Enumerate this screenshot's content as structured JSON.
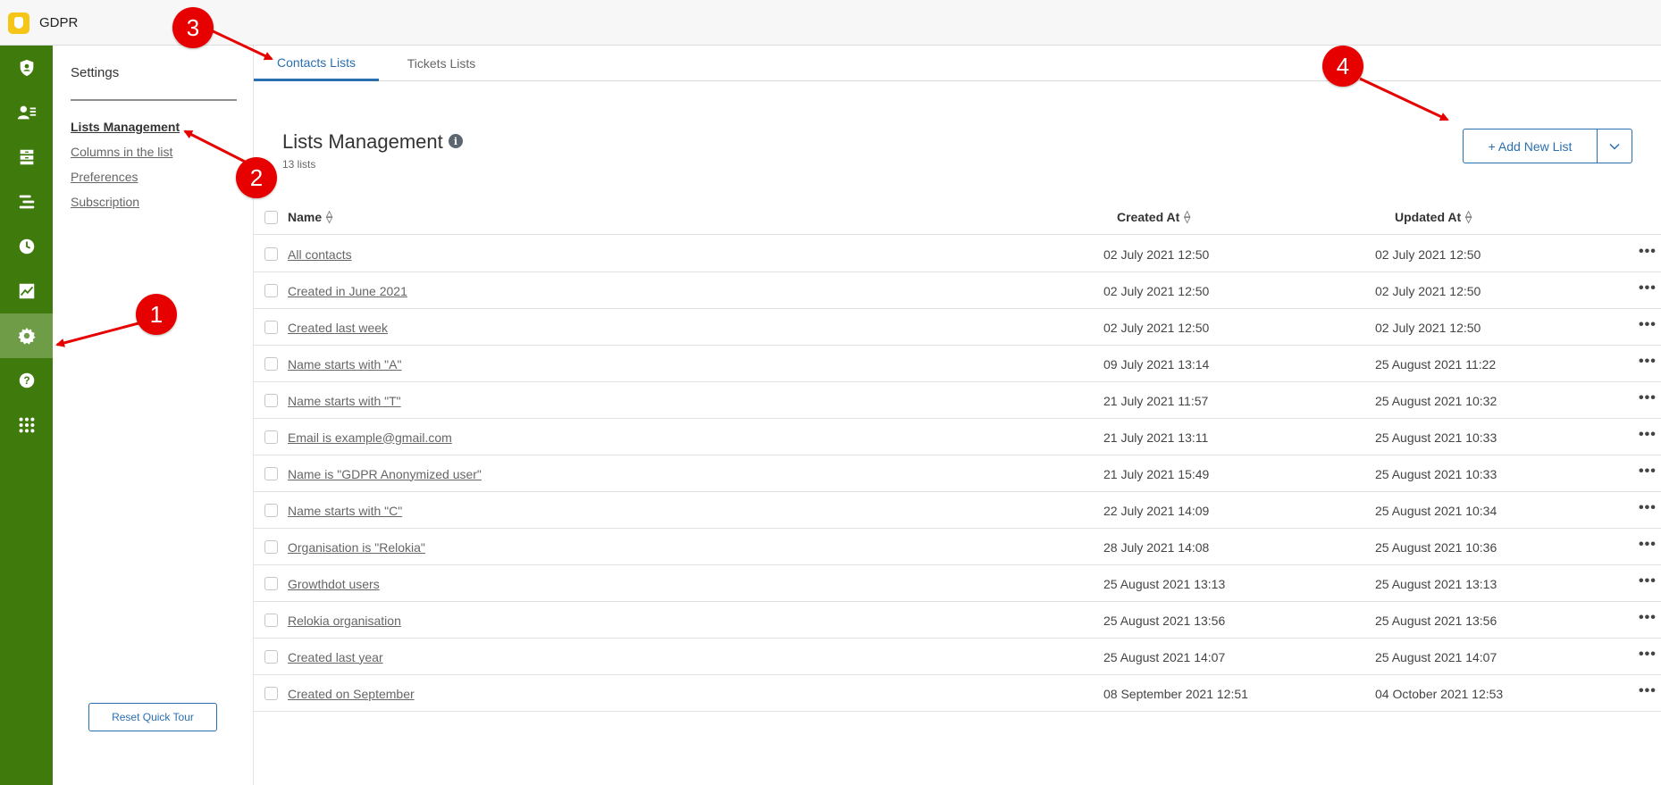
{
  "app": {
    "title": "GDPR",
    "logo_icon": "gdpr-logo-icon",
    "brand_color": "#3f7a0c"
  },
  "rail": {
    "items": [
      {
        "name": "gdpr-shield-icon"
      },
      {
        "name": "contacts-icon"
      },
      {
        "name": "archive-icon"
      },
      {
        "name": "lists-icon"
      },
      {
        "name": "clock-icon"
      },
      {
        "name": "chart-icon"
      },
      {
        "name": "gear-icon",
        "active": true
      },
      {
        "name": "help-icon"
      },
      {
        "name": "apps-grid-icon"
      }
    ]
  },
  "sidebar": {
    "title": "Settings",
    "links": [
      {
        "label": "Lists Management",
        "active": true
      },
      {
        "label": "Columns in the list"
      },
      {
        "label": "Preferences"
      },
      {
        "label": "Subscription"
      }
    ],
    "reset_label": "Reset Quick Tour"
  },
  "tabs": [
    {
      "label": "Contacts Lists",
      "active": true
    },
    {
      "label": "Tickets Lists"
    }
  ],
  "page": {
    "title": "Lists Management",
    "info_icon": "i",
    "count": "13 lists",
    "add_button": "+ Add New List"
  },
  "table": {
    "headers": {
      "name": "Name",
      "created": "Created At",
      "updated": "Updated At"
    },
    "rows": [
      {
        "name": "All contacts",
        "created": "02 July 2021 12:50",
        "updated": "02 July 2021 12:50"
      },
      {
        "name": "Created in June 2021",
        "created": "02 July 2021 12:50",
        "updated": "02 July 2021 12:50"
      },
      {
        "name": "Created last week",
        "created": "02 July 2021 12:50",
        "updated": "02 July 2021 12:50"
      },
      {
        "name": "Name starts with \"A\"",
        "created": "09 July 2021 13:14",
        "updated": "25 August 2021 11:22"
      },
      {
        "name": "Name starts with \"T\"",
        "created": "21 July 2021 11:57",
        "updated": "25 August 2021 10:32"
      },
      {
        "name": "Email is example@gmail.com",
        "created": "21 July 2021 13:11",
        "updated": "25 August 2021 10:33"
      },
      {
        "name": "Name is \"GDPR Anonymized user\"",
        "created": "21 July 2021 15:49",
        "updated": "25 August 2021 10:33"
      },
      {
        "name": "Name starts with \"C\"",
        "created": "22 July 2021 14:09",
        "updated": "25 August 2021 10:34"
      },
      {
        "name": "Organisation is \"Relokia\"",
        "created": "28 July 2021 14:08",
        "updated": "25 August 2021 10:36"
      },
      {
        "name": "Growthdot users",
        "created": "25 August 2021 13:13",
        "updated": "25 August 2021 13:13"
      },
      {
        "name": "Relokia organisation",
        "created": "25 August 2021 13:56",
        "updated": "25 August 2021 13:56"
      },
      {
        "name": "Created last year",
        "created": "25 August 2021 14:07",
        "updated": "25 August 2021 14:07"
      },
      {
        "name": "Created on September",
        "created": "08 September 2021 12:51",
        "updated": "04 October 2021 12:53"
      }
    ],
    "row_action": "•••"
  },
  "annotations": {
    "badges": [
      "1",
      "2",
      "3",
      "4"
    ],
    "color": "#e60000"
  }
}
